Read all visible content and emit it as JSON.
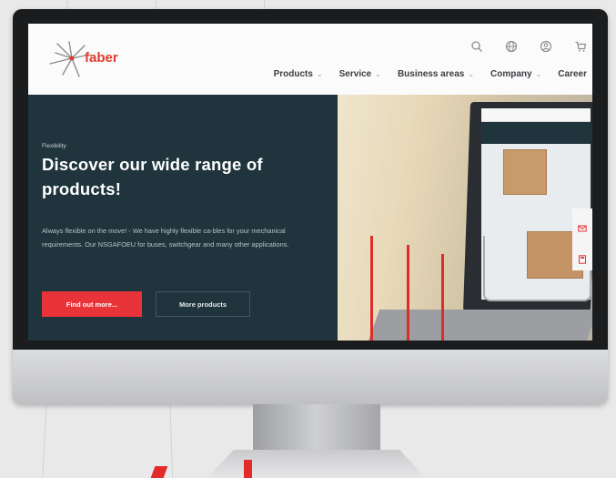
{
  "brand": {
    "name": "faber",
    "color": "#e03a2d"
  },
  "header": {
    "icons": [
      "search-icon",
      "globe-icon",
      "account-icon",
      "cart-icon"
    ],
    "nav": [
      {
        "label": "Products",
        "has_dropdown": true
      },
      {
        "label": "Service",
        "has_dropdown": true
      },
      {
        "label": "Business areas",
        "has_dropdown": true
      },
      {
        "label": "Company",
        "has_dropdown": true
      },
      {
        "label": "Career",
        "has_dropdown": false
      }
    ]
  },
  "hero": {
    "kicker": "Flexibility",
    "headline": "Discover our wide range of products!",
    "body": "Always flexible on the move! - We have highly flexible ca-bles for your mechanical requirements. Our NSGAFOEU for buses, switchgear and many other applications.",
    "primary_button": "Find out more...",
    "secondary_button": "More products",
    "colors": {
      "panel": "#1f343c",
      "accent": "#e83338"
    }
  },
  "side_tab": {
    "icons": [
      "mail-icon",
      "calculator-icon"
    ]
  }
}
